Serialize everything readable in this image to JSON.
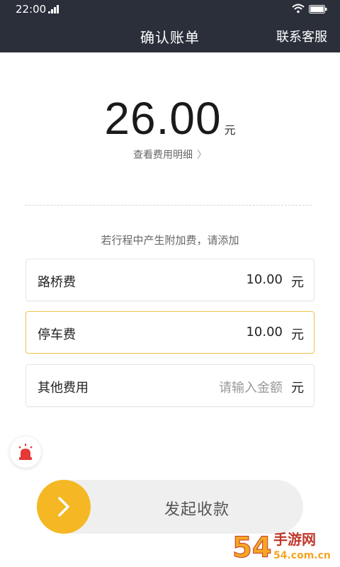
{
  "status": {
    "time": "22:00"
  },
  "navbar": {
    "title": "确认账单",
    "service": "联系客服"
  },
  "bill": {
    "amount": "26.00",
    "unit": "元",
    "detail_link": "查看费用明细",
    "hint": "若行程中产生附加费，请添加"
  },
  "fees": [
    {
      "label": "路桥费",
      "value": "10.00",
      "unit": "元"
    },
    {
      "label": "停车费",
      "value": "10.00",
      "unit": "元"
    },
    {
      "label": "其他费用",
      "placeholder": "请输入金额",
      "unit": "元"
    }
  ],
  "action": {
    "slider_label": "发起收款"
  },
  "watermark": {
    "brand": "手游网",
    "domain": "54.com.cn"
  },
  "colors": {
    "header_bg": "#2a2f3a",
    "accent": "#f5b824",
    "active_border": "#f2c64a",
    "alarm": "#e53935"
  }
}
